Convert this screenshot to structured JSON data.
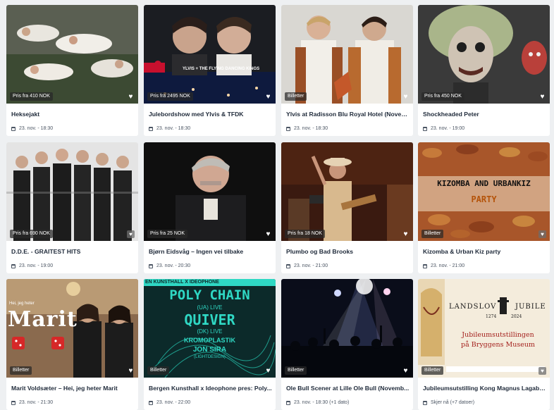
{
  "events": [
    {
      "title": "Heksejakt",
      "date": "23. nov. - 18:30",
      "badge": "Pris fra 410 NOK",
      "heart_icon": "heart-icon"
    },
    {
      "title": "Julebordshow med Ylvis & TFDK",
      "date": "23. nov. - 18:30",
      "badge": "Pris fra 2495 NOK",
      "poster_text": "YLVIS + THE FLYING DANCING KINGS",
      "heart_icon": "heart-icon"
    },
    {
      "title": "Ylvis at Radisson Blu Royal Hotel (November...",
      "date": "23. nov. - 18:30",
      "badge": "Billetter",
      "heart_icon": "heart-icon"
    },
    {
      "title": "Shockheaded Peter",
      "date": "23. nov. - 19:00",
      "badge": "Pris fra 450 NOK",
      "heart_icon": "heart-icon"
    },
    {
      "title": "D.D.E. - GRAITEST HITS",
      "date": "23. nov. - 19:00",
      "badge": "Pris fra 690 NOK",
      "heart_icon": "heart-icon"
    },
    {
      "title": "Bjørn Eidsvåg – Ingen vei tilbake",
      "date": "23. nov. - 20:30",
      "badge": "Pris fra 25 NOK",
      "heart_icon": "heart-icon"
    },
    {
      "title": "Plumbo og Bad Brooks",
      "date": "23. nov. - 21:00",
      "badge": "Pris fra 18 NOK",
      "heart_icon": "heart-icon"
    },
    {
      "title": "Kizomba & Urban Kiz party",
      "date": "23. nov. - 21:00",
      "badge": "Billetter",
      "poster_line1": "KIZOMBA AND URBANKIZ",
      "poster_line2": "PARTY",
      "heart_icon": "heart-icon"
    },
    {
      "title": "Marit Voldsæter – Hei, jeg heter Marit",
      "date": "23. nov. - 21:30",
      "badge": "Billetter",
      "poster_small": "Hei, jeg heter",
      "poster_big": "Marit",
      "heart_icon": "heart-icon"
    },
    {
      "title": "Bergen Kunsthall x Ideophone pres: Poly...",
      "date": "23. nov. - 22:00",
      "badge": "Billetter",
      "poster_top": "EN KUNSTHALL X IDEOPHONE",
      "poster_l1": "POLY CHAIN",
      "poster_l2": "(UA) LIVE",
      "poster_l3": "QUIVER",
      "poster_l4": "(DK) LIVE",
      "poster_l5": "KROMOPLASTIK",
      "poster_l6": "JON SIRA",
      "poster_l7": "(LIGHTDESIGN)",
      "heart_icon": "heart-icon"
    },
    {
      "title": "Ole Bull Scener at Lille Ole Bull (Novemb...",
      "date": "23. nov. - 18:30 (+1 dato)",
      "badge": "Billetter",
      "heart_icon": "heart-icon"
    },
    {
      "title": "Jubileumsutstilling Kong Magnus Lagabøte",
      "date": "Skjer nå (+7 datoer)",
      "badge": "Billetter",
      "poster_head": "LANDSLOV",
      "poster_head2": "JUBILE",
      "poster_y1": "1274",
      "poster_y2": "2024",
      "poster_sub1": "Jubileumsutstillingen",
      "poster_sub2": "på Bryggens Museum",
      "heart_icon": "heart-icon"
    }
  ]
}
